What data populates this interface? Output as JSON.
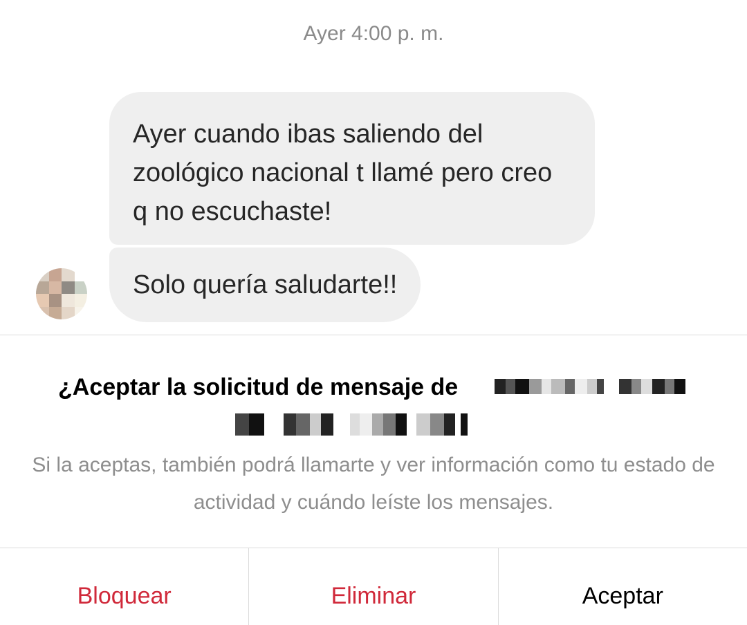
{
  "thread": {
    "timestamp": "Ayer 4:00 p. m.",
    "messages": [
      {
        "text": "Ayer cuando ibas saliendo del zoológico nacional t llamé pero creo q no escuchaste!"
      },
      {
        "text": "Solo quería saludarte!!"
      }
    ],
    "avatar": {
      "icon": "blurred-profile-photo"
    }
  },
  "request": {
    "title": "¿Aceptar la solicitud de mensaje de",
    "description": "Si la aceptas, también podrá llamarte y ver información como tu estado de actividad y cuándo leíste los mensajes."
  },
  "actions": {
    "block_label": "Bloquear",
    "delete_label": "Eliminar",
    "accept_label": "Aceptar"
  },
  "colors": {
    "danger": "#d0293a",
    "bubble": "#efefef",
    "muted_text": "#8e8e8e"
  }
}
